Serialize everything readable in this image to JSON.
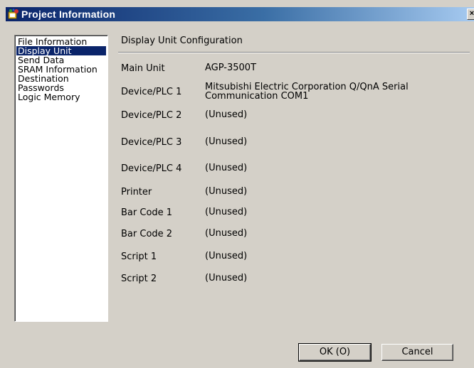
{
  "window": {
    "title": "Project Information",
    "close_label": "×"
  },
  "nav": {
    "items": [
      {
        "label": "File Information",
        "selected": false
      },
      {
        "label": "Display Unit",
        "selected": true
      },
      {
        "label": "Send Data",
        "selected": false
      },
      {
        "label": "SRAM Information",
        "selected": false
      },
      {
        "label": "Destination",
        "selected": false
      },
      {
        "label": "Passwords",
        "selected": false
      },
      {
        "label": "Logic Memory",
        "selected": false
      }
    ]
  },
  "main": {
    "section_title": "Display Unit Configuration",
    "rows": [
      {
        "key": "Main Unit",
        "value": "AGP-3500T"
      },
      {
        "key": "Device/PLC 1",
        "value": "Mitsubishi Electric Corporation Q/QnA Serial Communication COM1"
      },
      {
        "key": "Device/PLC 2",
        "value": "(Unused)"
      },
      {
        "key": "Device/PLC 3",
        "value": "(Unused)"
      },
      {
        "key": "Device/PLC 4",
        "value": "(Unused)"
      },
      {
        "key": "Printer",
        "value": "(Unused)"
      },
      {
        "key": "Bar Code 1",
        "value": "(Unused)"
      },
      {
        "key": "Bar Code 2",
        "value": "(Unused)"
      },
      {
        "key": "Script 1",
        "value": "(Unused)"
      },
      {
        "key": "Script 2",
        "value": "(Unused)"
      }
    ]
  },
  "buttons": {
    "ok_label": "OK (O)",
    "cancel_label": "Cancel"
  }
}
